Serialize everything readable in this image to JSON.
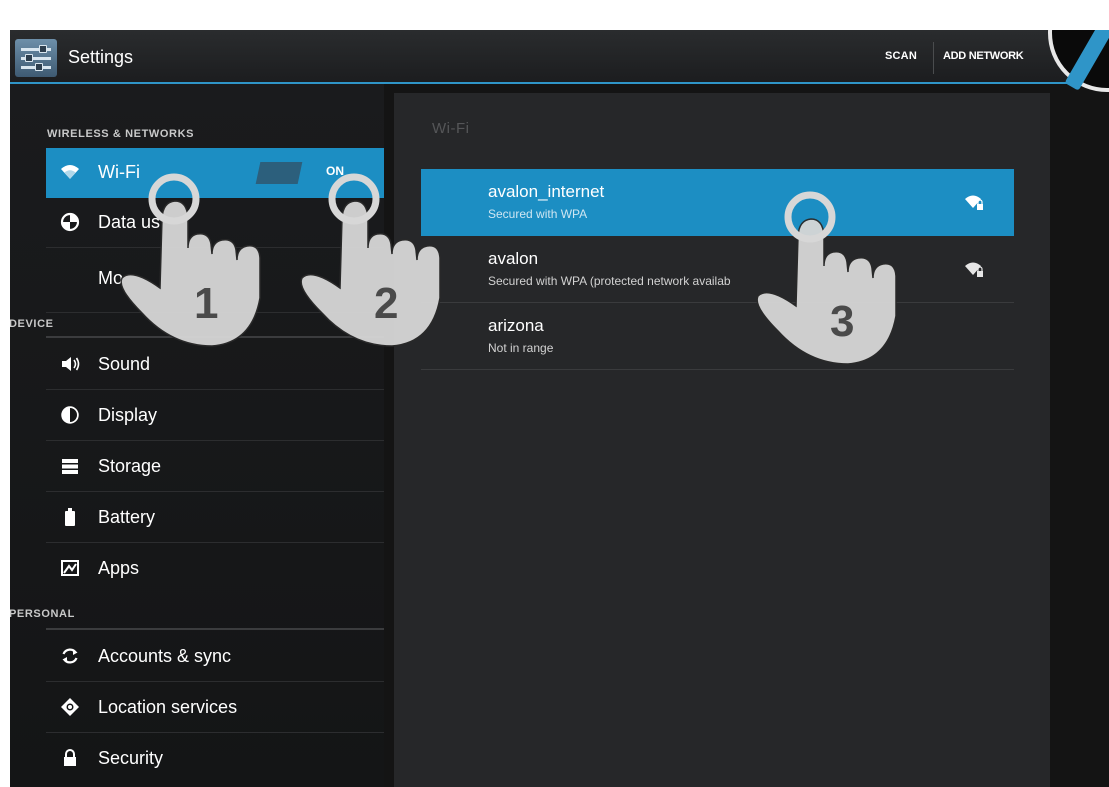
{
  "app": {
    "title": "Settings"
  },
  "actionbar": {
    "scan_label": "SCAN",
    "add_network_label": "ADD NETWORK"
  },
  "sidebar": {
    "sections": [
      {
        "header": "WIRELESS & NETWORKS"
      },
      {
        "header": "DEVICE"
      },
      {
        "header": "PERSONAL"
      }
    ],
    "items": [
      {
        "label": "Wi-Fi",
        "icon": "wifi-icon",
        "toggle": "ON",
        "selected": true
      },
      {
        "label": "Data us",
        "icon": "data-usage-icon"
      },
      {
        "label": "Mo",
        "icon": ""
      },
      {
        "label": "Sound",
        "icon": "speaker-icon"
      },
      {
        "label": "Display",
        "icon": "display-icon"
      },
      {
        "label": "Storage",
        "icon": "storage-icon"
      },
      {
        "label": "Battery",
        "icon": "battery-icon"
      },
      {
        "label": "Apps",
        "icon": "apps-icon"
      },
      {
        "label": "Accounts & sync",
        "icon": "sync-icon"
      },
      {
        "label": "Location services",
        "icon": "location-icon"
      },
      {
        "label": "Security",
        "icon": "lock-icon"
      }
    ]
  },
  "wifi_panel": {
    "title": "Wi-Fi",
    "networks": [
      {
        "name": "avalon_internet",
        "status": "Secured with WPA",
        "selected": true,
        "signal_icon": "wifi-signal-locked-icon"
      },
      {
        "name": "avalon",
        "status": "Secured with WPA (protected network availab",
        "signal_icon": "wifi-signal-locked-icon"
      },
      {
        "name": "arizona",
        "status": "Not in range"
      }
    ]
  },
  "gestures": [
    {
      "step": "1"
    },
    {
      "step": "2"
    },
    {
      "step": "3"
    }
  ],
  "colors": {
    "accent": "#1c8ec3",
    "actionbar_underline": "#2f95c8",
    "background": "#141414",
    "panel": "#262729"
  }
}
